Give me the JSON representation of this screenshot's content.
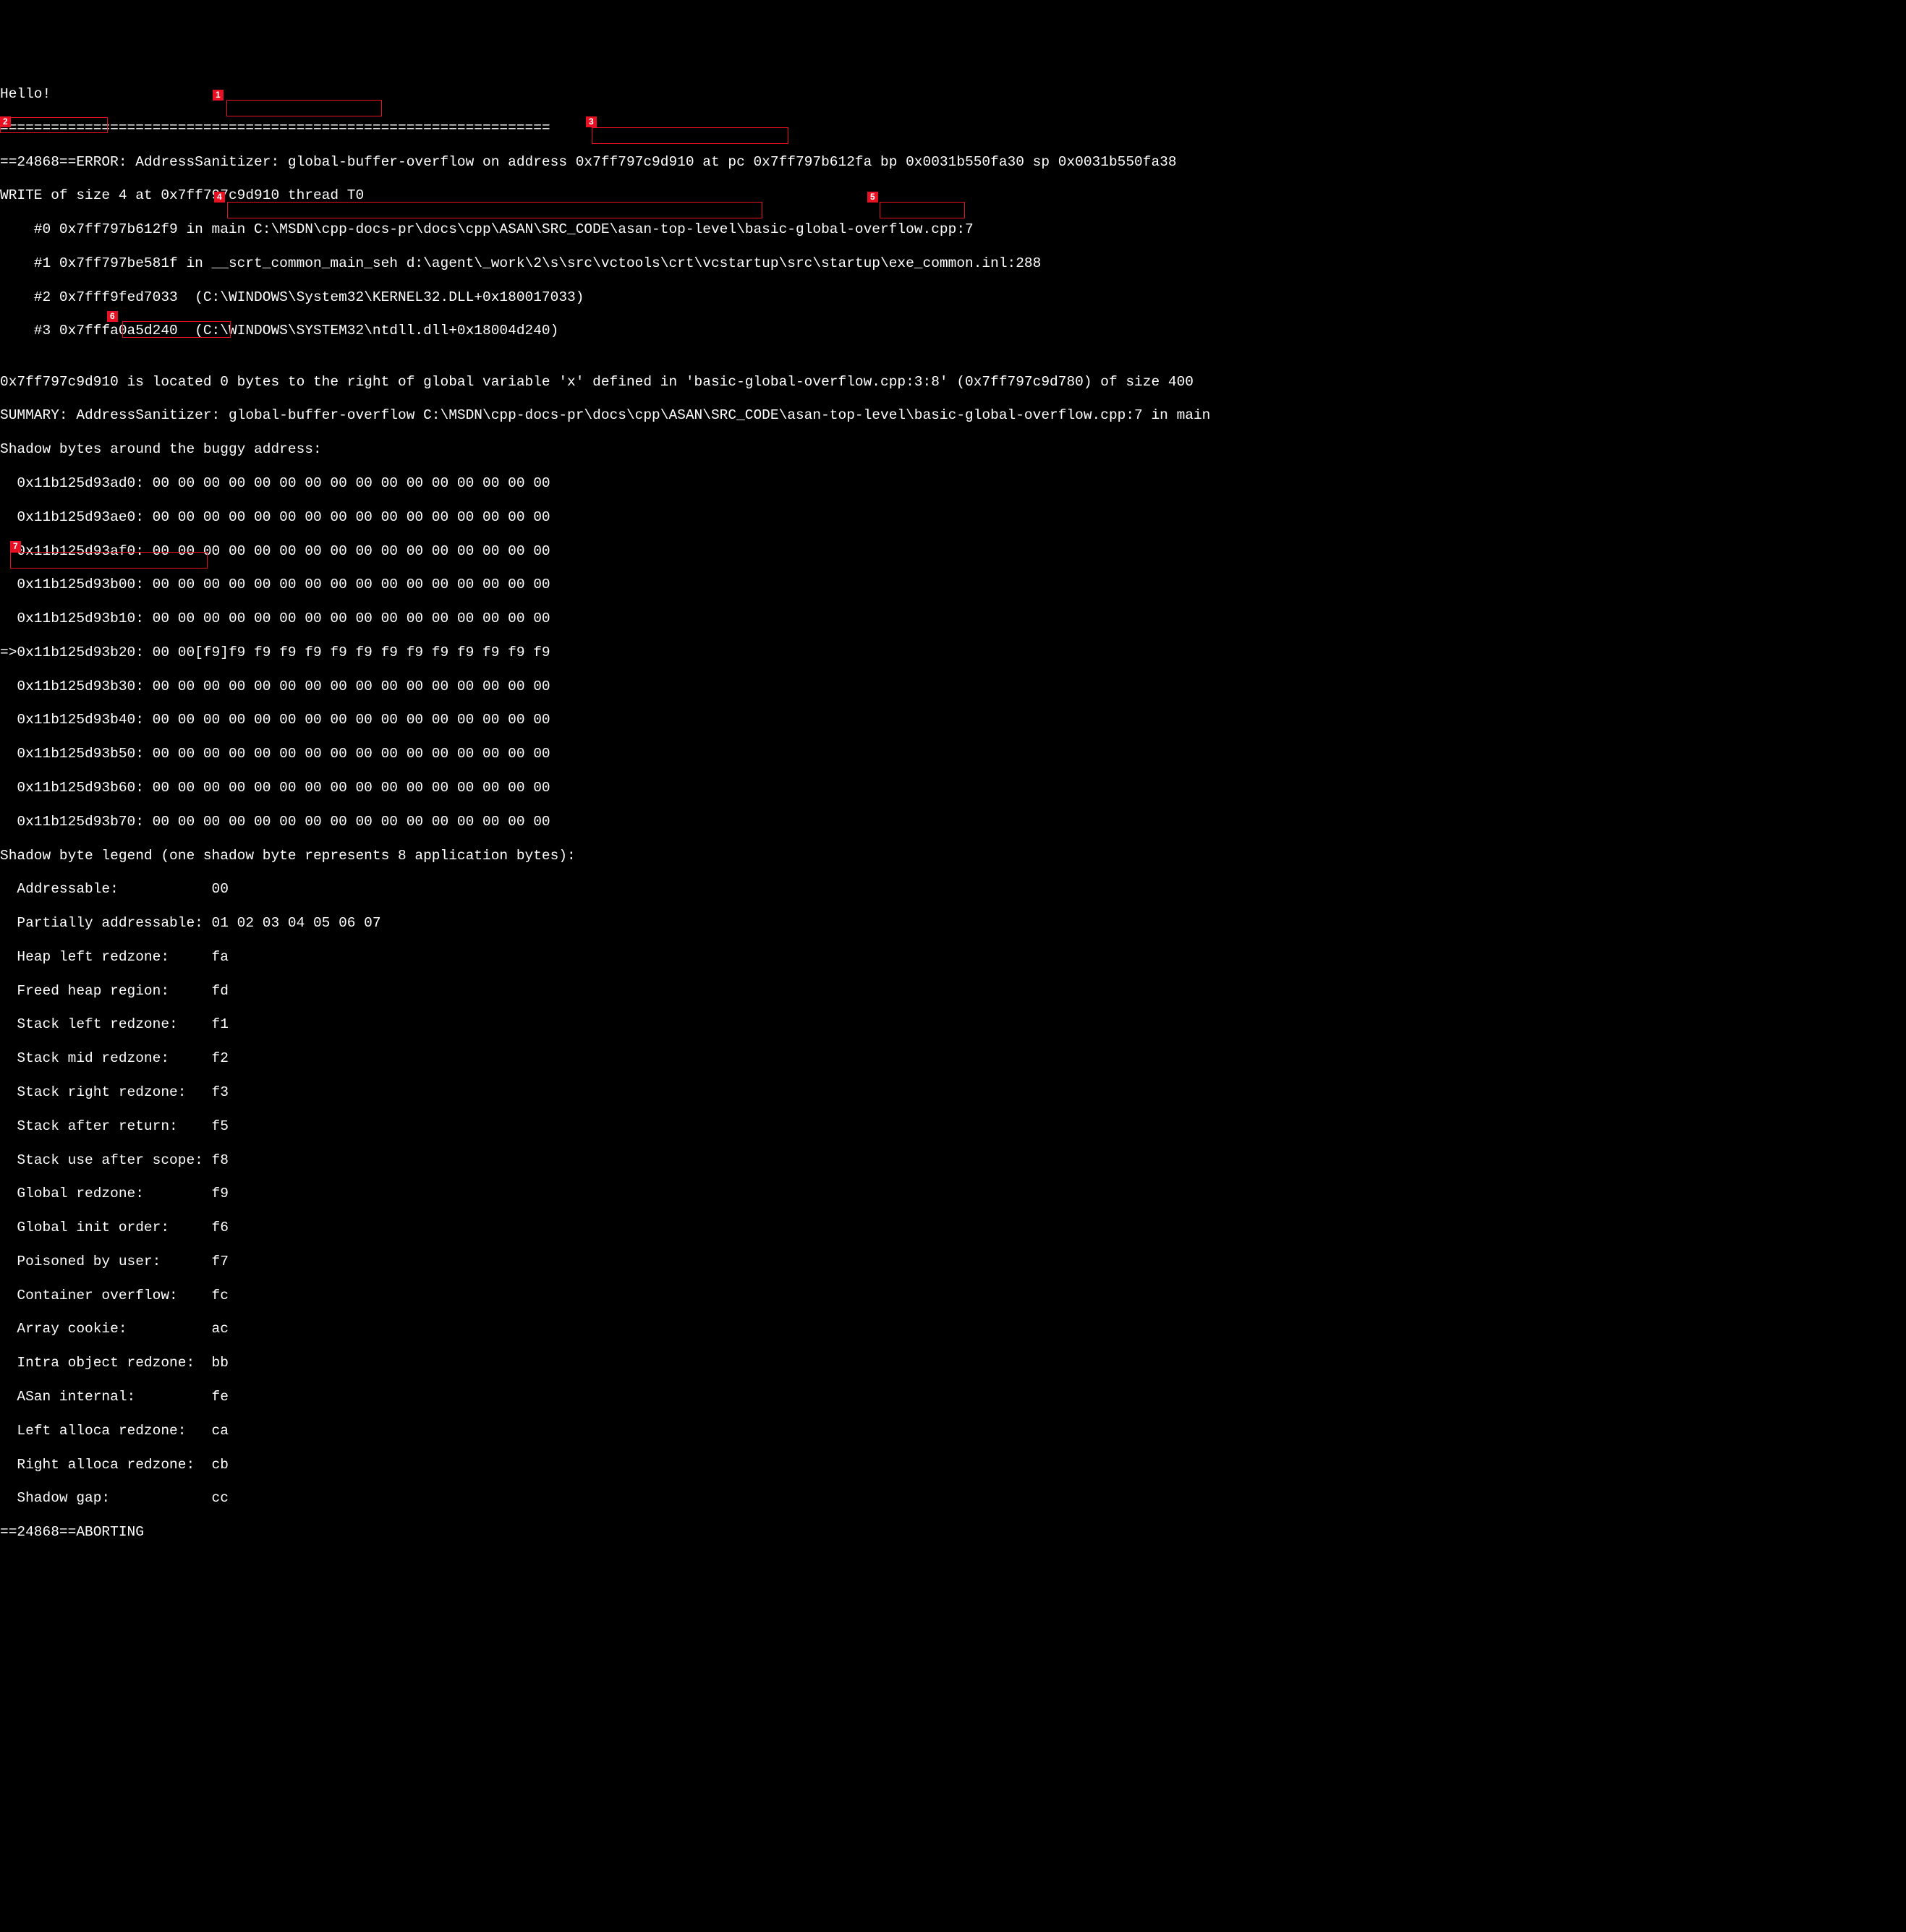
{
  "annotations": {
    "a1": "1",
    "a2": "2",
    "a3": "3",
    "a4": "4",
    "a5": "5",
    "a6": "6",
    "a7": "7"
  },
  "lines": {
    "l0": "Hello!",
    "l1": "=================================================================",
    "l2": "==24868==ERROR: AddressSanitizer: global-buffer-overflow on address 0x7ff797c9d910 at pc 0x7ff797b612fa bp 0x0031b550fa30 sp 0x0031b550fa38",
    "l3": "WRITE of size 4 at 0x7ff797c9d910 thread T0",
    "l4": "    #0 0x7ff797b612f9 in main C:\\MSDN\\cpp-docs-pr\\docs\\cpp\\ASAN\\SRC_CODE\\asan-top-level\\basic-global-overflow.cpp:7",
    "l5": "    #1 0x7ff797be581f in __scrt_common_main_seh d:\\agent\\_work\\2\\s\\src\\vctools\\crt\\vcstartup\\src\\startup\\exe_common.inl:288",
    "l6": "    #2 0x7fff9fed7033  (C:\\WINDOWS\\System32\\KERNEL32.DLL+0x180017033)",
    "l7": "    #3 0x7fffa0a5d240  (C:\\WINDOWS\\SYSTEM32\\ntdll.dll+0x18004d240)",
    "l8": "",
    "l9": "0x7ff797c9d910 is located 0 bytes to the right of global variable 'x' defined in 'basic-global-overflow.cpp:3:8' (0x7ff797c9d780) of size 400",
    "l10": "SUMMARY: AddressSanitizer: global-buffer-overflow C:\\MSDN\\cpp-docs-pr\\docs\\cpp\\ASAN\\SRC_CODE\\asan-top-level\\basic-global-overflow.cpp:7 in main",
    "l11": "Shadow bytes around the buggy address:",
    "l12": "  0x11b125d93ad0: 00 00 00 00 00 00 00 00 00 00 00 00 00 00 00 00",
    "l13": "  0x11b125d93ae0: 00 00 00 00 00 00 00 00 00 00 00 00 00 00 00 00",
    "l14": "  0x11b125d93af0: 00 00 00 00 00 00 00 00 00 00 00 00 00 00 00 00",
    "l15": "  0x11b125d93b00: 00 00 00 00 00 00 00 00 00 00 00 00 00 00 00 00",
    "l16": "  0x11b125d93b10: 00 00 00 00 00 00 00 00 00 00 00 00 00 00 00 00",
    "l17": "=>0x11b125d93b20: 00 00[f9]f9 f9 f9 f9 f9 f9 f9 f9 f9 f9 f9 f9 f9",
    "l18": "  0x11b125d93b30: 00 00 00 00 00 00 00 00 00 00 00 00 00 00 00 00",
    "l19": "  0x11b125d93b40: 00 00 00 00 00 00 00 00 00 00 00 00 00 00 00 00",
    "l20": "  0x11b125d93b50: 00 00 00 00 00 00 00 00 00 00 00 00 00 00 00 00",
    "l21": "  0x11b125d93b60: 00 00 00 00 00 00 00 00 00 00 00 00 00 00 00 00",
    "l22": "  0x11b125d93b70: 00 00 00 00 00 00 00 00 00 00 00 00 00 00 00 00",
    "l23": "Shadow byte legend (one shadow byte represents 8 application bytes):",
    "l24": "  Addressable:           00",
    "l25": "  Partially addressable: 01 02 03 04 05 06 07",
    "l26": "  Heap left redzone:     fa",
    "l27": "  Freed heap region:     fd",
    "l28": "  Stack left redzone:    f1",
    "l29": "  Stack mid redzone:     f2",
    "l30": "  Stack right redzone:   f3",
    "l31": "  Stack after return:    f5",
    "l32": "  Stack use after scope: f8",
    "l33": "  Global redzone:        f9",
    "l34": "  Global init order:     f6",
    "l35": "  Poisoned by user:      f7",
    "l36": "  Container overflow:    fc",
    "l37": "  Array cookie:          ac",
    "l38": "  Intra object redzone:  bb",
    "l39": "  ASan internal:         fe",
    "l40": "  Left alloca redzone:   ca",
    "l41": "  Right alloca redzone:  cb",
    "l42": "  Shadow gap:            cc",
    "l43": "==24868==ABORTING"
  }
}
